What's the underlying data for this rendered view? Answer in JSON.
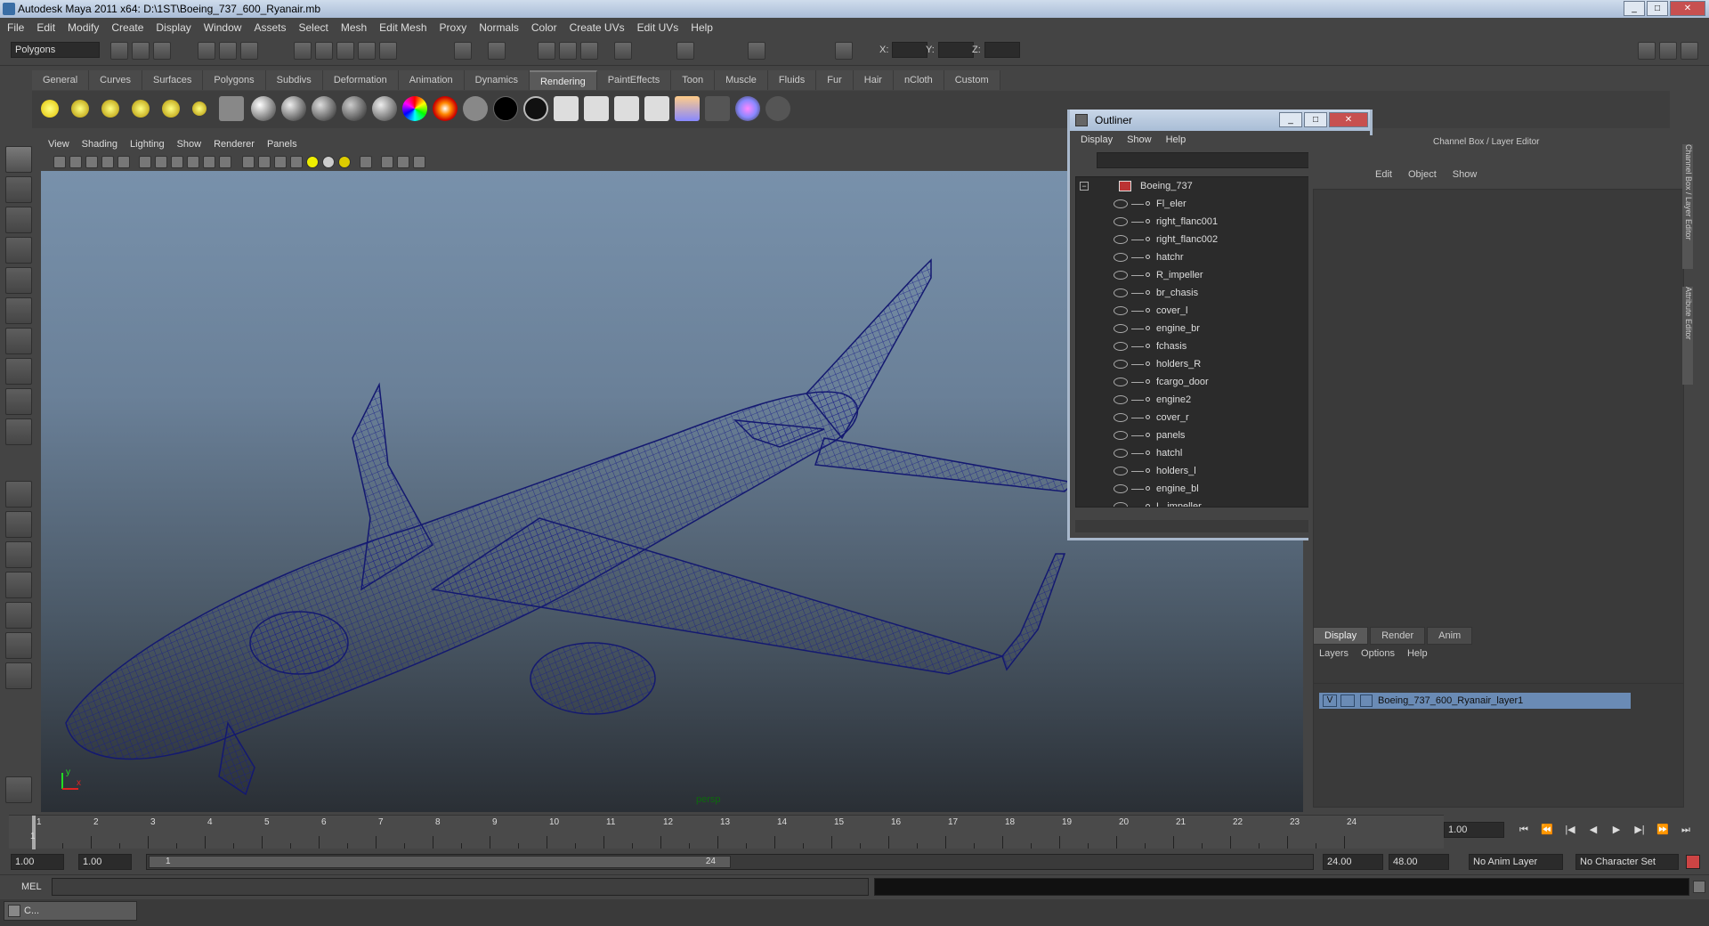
{
  "window": {
    "title": "Autodesk Maya 2011 x64: D:\\1ST\\Boeing_737_600_Ryanair.mb",
    "min": "_",
    "max": "□",
    "close": "✕"
  },
  "menubar": [
    "File",
    "Edit",
    "Modify",
    "Create",
    "Display",
    "Window",
    "Assets",
    "Select",
    "Mesh",
    "Edit Mesh",
    "Proxy",
    "Normals",
    "Color",
    "Create UVs",
    "Edit UVs",
    "Help"
  ],
  "status": {
    "mode": "Polygons",
    "x_label": "X:",
    "y_label": "Y:",
    "z_label": "Z:"
  },
  "shelf_tabs": [
    "General",
    "Curves",
    "Surfaces",
    "Polygons",
    "Subdivs",
    "Deformation",
    "Animation",
    "Dynamics",
    "Rendering",
    "PaintEffects",
    "Toon",
    "Muscle",
    "Fluids",
    "Fur",
    "Hair",
    "nCloth",
    "Custom"
  ],
  "active_shelf_tab": "Rendering",
  "viewport_menu": [
    "View",
    "Shading",
    "Lighting",
    "Show",
    "Renderer",
    "Panels"
  ],
  "viewport": {
    "camera_label": "persp",
    "axis_y": "y",
    "axis_x": "x",
    "wire_color": "#141970"
  },
  "outliner": {
    "title": "Outliner",
    "menu": [
      "Display",
      "Show",
      "Help"
    ],
    "root": "Boeing_737",
    "items": [
      "Fl_eler",
      "right_flanc001",
      "right_flanc002",
      "hatchr",
      "R_impeller",
      "br_chasis",
      "cover_l",
      "engine_br",
      "fchasis",
      "holders_R",
      "fcargo_door",
      "engine2",
      "cover_r",
      "panels",
      "hatchl",
      "holders_l",
      "engine_bl",
      "L_impeller"
    ]
  },
  "channel_box": {
    "title": "Channel Box / Layer Editor",
    "menu": [
      "Edit",
      "Object",
      "Show"
    ],
    "side_tabs": [
      "Channel Box / Layer Editor",
      "Attribute Editor"
    ]
  },
  "layer_editor": {
    "tabs": [
      "Display",
      "Render",
      "Anim"
    ],
    "active_tab": "Display",
    "menu": [
      "Layers",
      "Options",
      "Help"
    ],
    "layer": {
      "visible": "V",
      "name": "Boeing_737_600_Ryanair_layer1"
    }
  },
  "timeline": {
    "ticks": [
      "1",
      "2",
      "3",
      "4",
      "5",
      "6",
      "7",
      "8",
      "9",
      "10",
      "11",
      "12",
      "13",
      "14",
      "15",
      "16",
      "17",
      "18",
      "19",
      "20",
      "21",
      "22",
      "23",
      "24"
    ],
    "current_frame": "1",
    "current_time_field": "1.00"
  },
  "range": {
    "start": "1.00",
    "anim_start": "1.00",
    "range_start_label": "1",
    "range_end_label": "24",
    "end": "24.00",
    "anim_end": "48.00",
    "anim_layer": "No Anim Layer",
    "character_set": "No Character Set"
  },
  "cmdline": {
    "label": "MEL"
  },
  "taskbar": {
    "item": "C..."
  }
}
